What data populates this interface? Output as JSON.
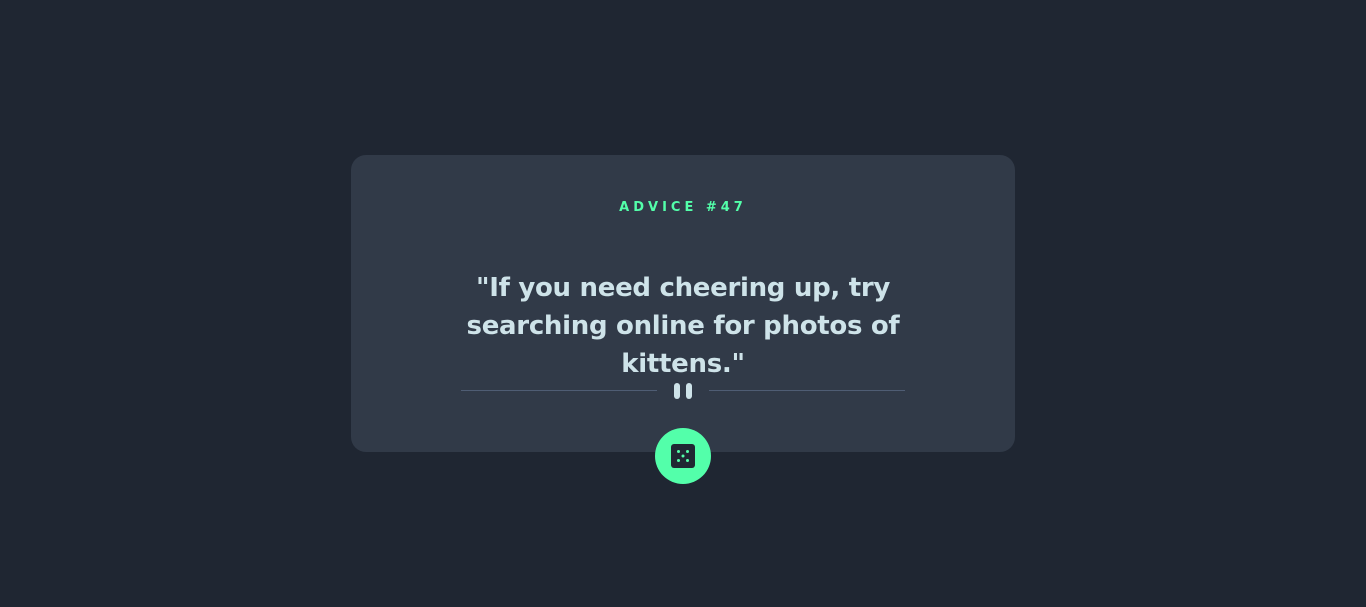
{
  "card": {
    "advice_label": "ADVICE #47",
    "advice_text": "\"If you need cheering up, try searching online for photos of kittens.\""
  },
  "divider": {
    "icon": "pause-icon"
  },
  "button": {
    "icon": "dice-icon"
  },
  "colors": {
    "background": "#1f2632",
    "card": "#313a48",
    "accent": "#53ffaa",
    "text": "#cee3e9",
    "divider": "#4f5d74"
  }
}
